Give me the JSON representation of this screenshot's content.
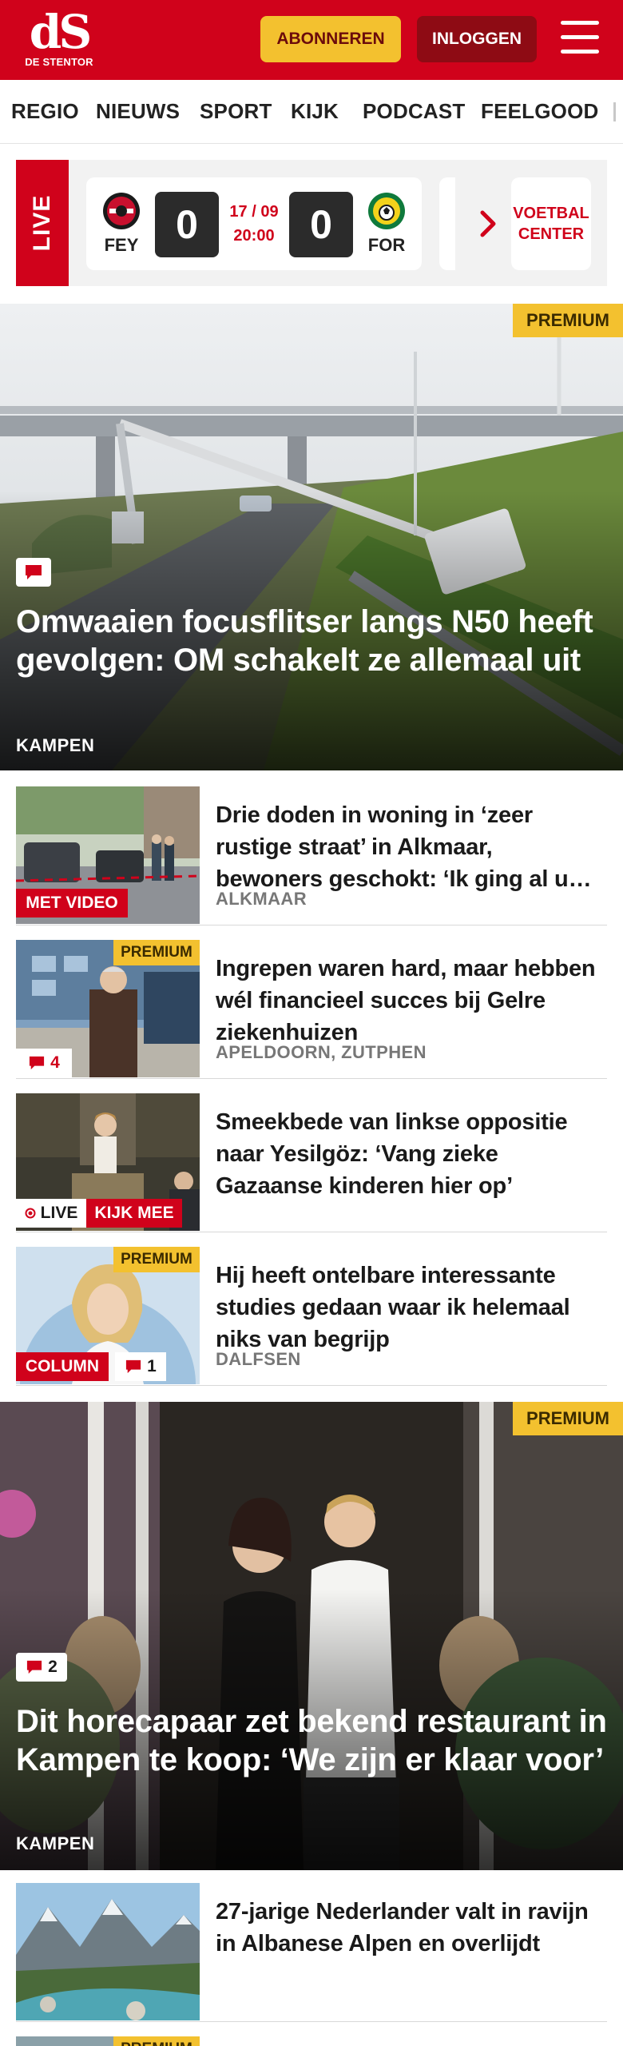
{
  "brand": {
    "logo_mark": "dS",
    "logo_text": "DE STENTOR",
    "red": "#d0021b",
    "yellow": "#f3c12f"
  },
  "header": {
    "subscribe_label": "ABONNEREN",
    "login_label": "INLOGGEN",
    "menu_icon": "hamburger-icon"
  },
  "nav": {
    "items": [
      "REGIO",
      "NIEUWS",
      "SPORT",
      "KIJK",
      "PODCAST",
      "FEELGOOD"
    ]
  },
  "live_widget": {
    "tag": "LIVE",
    "home_team": "FEY",
    "home_score": "0",
    "away_team": "FOR",
    "away_score": "0",
    "date": "17 / 09",
    "time": "20:00",
    "link_label": "VOETBAL CENTER"
  },
  "hero1": {
    "badge": "PREMIUM",
    "title": "Omwaaien focusflitser langs N50 heeft gevolgen: OM schakelt ze allemaal uit",
    "location": "KAMPEN"
  },
  "articles": [
    {
      "title": "Drie doden in woning in ‘zeer rustige straat’ in Alkmaar, bewoners geschokt: ‘Ik ging al u…",
      "location": "ALKMAAR",
      "tag": "MET VIDEO"
    },
    {
      "title": "Ingrepen waren hard, maar hebben wél financieel succes bij Gelre ziekenhuizen",
      "location": "APELDOORN, ZUTPHEN",
      "badge": "PREMIUM",
      "comments": "4"
    },
    {
      "title": "Smeekbede van linkse oppositie naar Yesilgöz: ‘Vang zieke Gazaanse kinderen hier op’",
      "live_label": "LIVE",
      "tag": "KIJK MEE"
    },
    {
      "title": "Hij heeft ontelbare interessante studies gedaan waar ik helemaal niks van begrijp",
      "location": "DALFSEN",
      "badge": "PREMIUM",
      "tag": "COLUMN",
      "comments": "1"
    }
  ],
  "hero2": {
    "badge": "PREMIUM",
    "comments": "2",
    "title": "Dit horecapaar zet bekend restaurant in Kampen te koop: ‘We zijn er klaar voor’",
    "location": "KAMPEN"
  },
  "article5": {
    "title": "27-jarige Nederlander valt in ravijn in Albanese Alpen en overlijdt"
  },
  "article6": {
    "badge": "PREMIUM"
  }
}
